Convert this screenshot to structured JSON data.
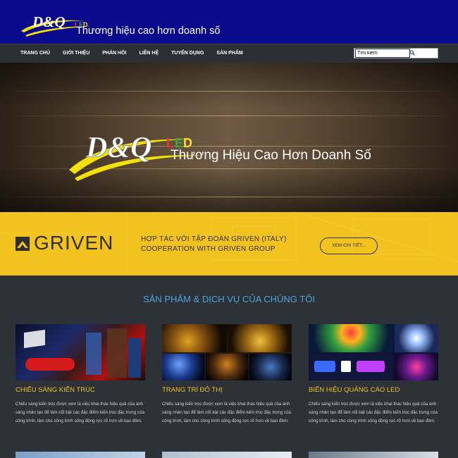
{
  "header": {
    "logo_text": "D&Q LED",
    "slogan": "Thương hiệu cao hơn doanh số"
  },
  "nav": {
    "items": [
      "TRANG CHỦ",
      "GIỚI THIỆU",
      "PHẢN HỒI",
      "LIÊN HỆ",
      "TUYỂN DỤNG",
      "SẢN PHẨM"
    ]
  },
  "search": {
    "value": "Tìm kiếm"
  },
  "hero": {
    "logo_text": "D&Q LED",
    "slogan": "Thương Hiệu Cao Hơn Doanh Số"
  },
  "partner": {
    "brand": "GRIVEN",
    "line1": "HỢP TÁC VỚI TẬP ĐOÀN GRIVEN (ITALY)",
    "line2": "COOPERATION WITH GRIVEN GROUP",
    "button": "XEM CHI TIẾT..."
  },
  "services": {
    "title": "SẢN PHẨM & DỊCH VỤ CỦA CHÚNG TÔI",
    "cards": [
      {
        "title": "CHIẾU SÁNG KIẾN TRÚC",
        "desc": "Chiếu sáng kiến trúc được xem là việc khai thác hiệu quả của ánh sáng nhân tạo để làm nổi bật các đặc điểm kiến trúc đặc trưng của công trình, làm cho công trình sống động rực rỡ hơn về ban đêm."
      },
      {
        "title": "TRANG TRÍ ĐÔ THỊ",
        "desc": "Chiếu sáng kiến trúc được xem là việc khai thác hiệu quả của ánh sáng nhân tạo để làm nổi bật các đặc điểm kiến trúc đặc trưng của công trình, làm cho công trình sống động rực rỡ hơn về ban đêm."
      },
      {
        "title": "BIỂN HIỆU QUẢNG CÁO LED",
        "desc": "Chiếu sáng kiến trúc được xem là việc khai thác hiệu quả của ánh sáng nhân tạo để làm nổi bật các đặc điểm kiến trúc đặc trưng của công trình, làm cho công trình sống động rực rỡ hơn về ban đêm."
      }
    ]
  },
  "colors": {
    "header_bg": "#0b0a8c",
    "nav_bg": "#2b3034",
    "partner_bg": "#f2c21f",
    "title_blue": "#4ea3d8",
    "card_title": "#f0c021",
    "page_bg": "#2c3238"
  }
}
